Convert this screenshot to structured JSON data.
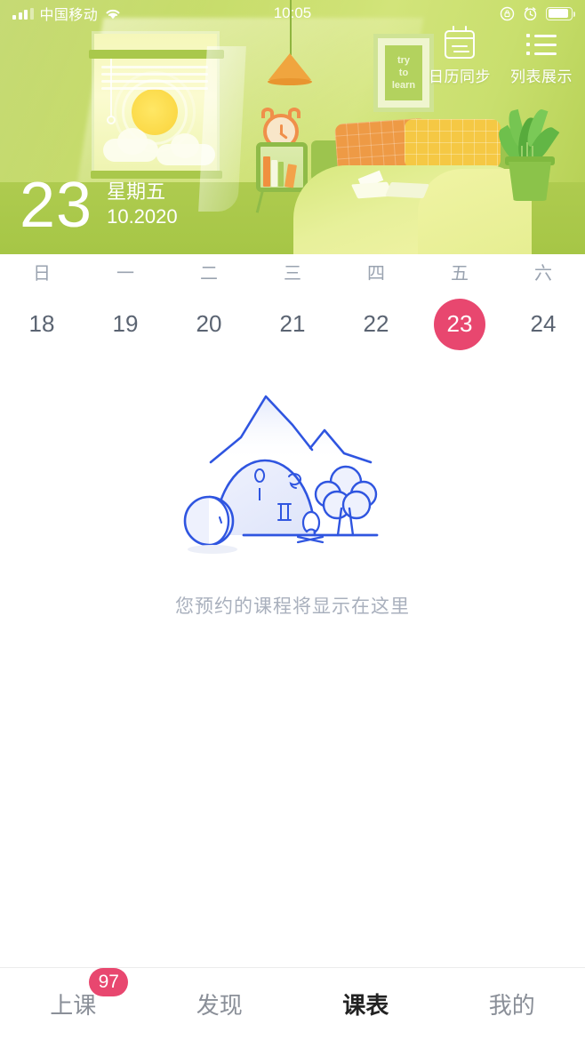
{
  "status_bar": {
    "carrier": "中国移动",
    "time": "10:05",
    "icons": [
      "signal-bars-icon",
      "wifi-icon",
      "rotation-lock-icon",
      "alarm-icon",
      "battery-icon"
    ]
  },
  "header": {
    "day": "23",
    "weekday": "星期五",
    "year_month": "10.2020",
    "picture_text": [
      "try",
      "to",
      "learn"
    ],
    "actions": [
      {
        "label": "日历同步",
        "icon": "calendar-sync-icon"
      },
      {
        "label": "列表展示",
        "icon": "list-view-icon"
      }
    ]
  },
  "week_strip": {
    "days": [
      {
        "dow": "日",
        "date": "18",
        "selected": false
      },
      {
        "dow": "一",
        "date": "19",
        "selected": false
      },
      {
        "dow": "二",
        "date": "20",
        "selected": false
      },
      {
        "dow": "三",
        "date": "21",
        "selected": false
      },
      {
        "dow": "四",
        "date": "22",
        "selected": false
      },
      {
        "dow": "五",
        "date": "23",
        "selected": true
      },
      {
        "dow": "六",
        "date": "24",
        "selected": false
      }
    ],
    "selected_color": "#e8476f"
  },
  "empty_state": {
    "illustration": "camping-tent-mountain-illustration",
    "message": "您预约的课程将显示在这里",
    "line_color": "#2f55e0"
  },
  "tab_bar": {
    "tabs": [
      {
        "label": "上课",
        "active": false,
        "badge": "97"
      },
      {
        "label": "发现",
        "active": false,
        "badge": ""
      },
      {
        "label": "课表",
        "active": true,
        "badge": ""
      },
      {
        "label": "我的",
        "active": false,
        "badge": ""
      }
    ],
    "active_highlight_color": "#ccd4f7",
    "badge_color": "#e8476f"
  }
}
